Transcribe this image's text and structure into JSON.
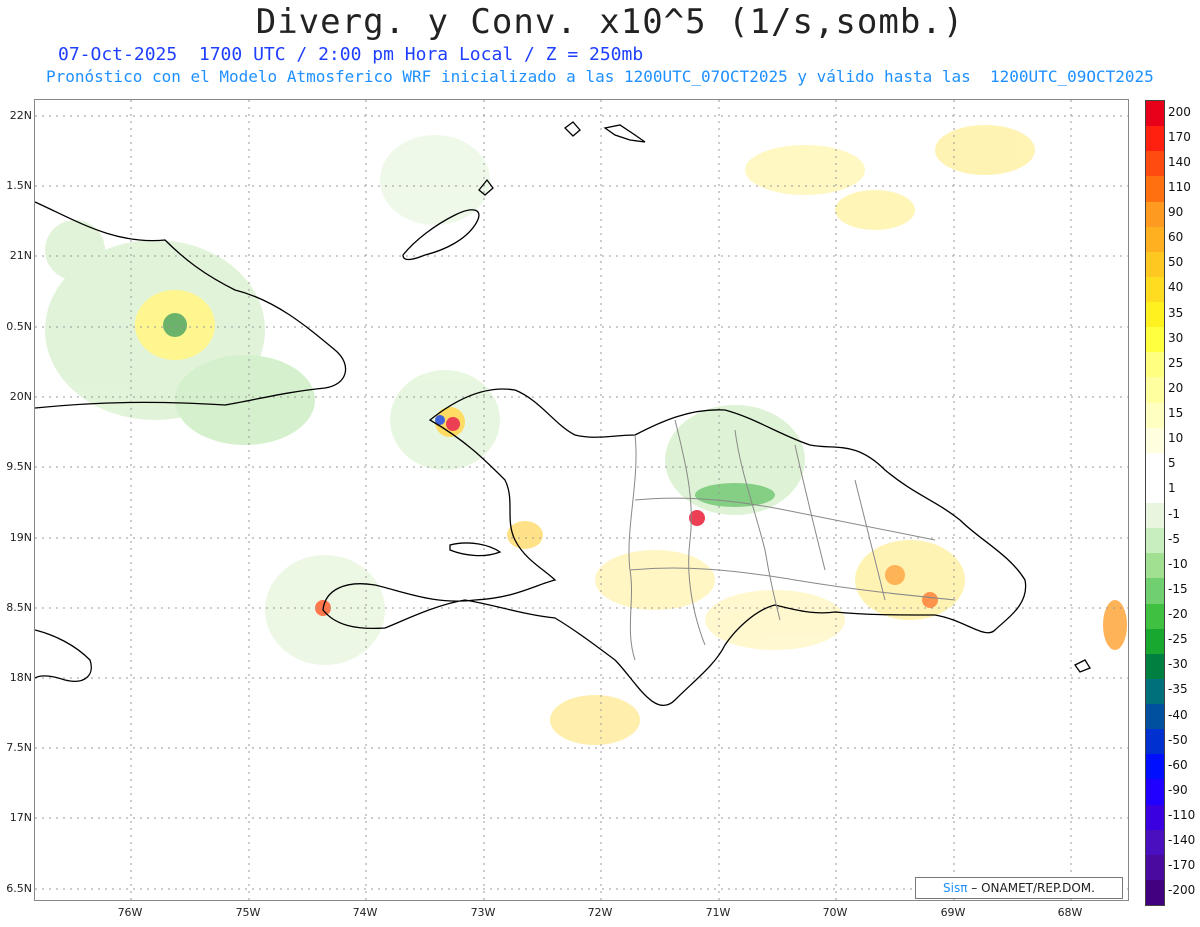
{
  "header": {
    "title": "Diverg. y Conv. x10^5 (1/s,somb.)",
    "line1": "07-Oct-2025  1700 UTC / 2:00 pm Hora Local / Z = 250mb",
    "line2": "Pronóstico con el Modelo Atmosferico WRF inicializado a las 1200UTC_07OCT2025 y válido hasta las  1200UTC_09OCT2025"
  },
  "map": {
    "lat_labels": [
      "22N",
      "1.5N",
      "21N",
      "0.5N",
      "20N",
      "9.5N",
      "19N",
      "8.5N",
      "18N",
      "7.5N",
      "17N",
      "6.5N"
    ],
    "lon_labels": [
      "76W",
      "75W",
      "74W",
      "73W",
      "72W",
      "71W",
      "70W",
      "69W",
      "68W"
    ],
    "credit_logo": "Sisπ",
    "credit_text": "– ONAMET/REP.DOM."
  },
  "colorbar": {
    "labels": [
      "200",
      "170",
      "140",
      "110",
      "90",
      "60",
      "50",
      "40",
      "35",
      "30",
      "25",
      "20",
      "15",
      "10",
      "5",
      "1",
      "-1",
      "-5",
      "-10",
      "-15",
      "-20",
      "-25",
      "-30",
      "-35",
      "-40",
      "-50",
      "-60",
      "-90",
      "-110",
      "-140",
      "-170",
      "-200"
    ],
    "colors": [
      "#e8001a",
      "#ff2010",
      "#ff4a10",
      "#ff7010",
      "#ff9a20",
      "#ffb020",
      "#ffc820",
      "#ffdc20",
      "#fff020",
      "#ffff40",
      "#ffff80",
      "#ffffa0",
      "#ffffc0",
      "#ffffe0",
      "#ffffff",
      "#ffffff",
      "#e8f6e0",
      "#c8eec0",
      "#a0e090",
      "#70d070",
      "#40c040",
      "#18a830",
      "#008040",
      "#00707a",
      "#0050a0",
      "#0030d0",
      "#0010ff",
      "#2000ff",
      "#3a00e0",
      "#4a10c0",
      "#4a0aa0",
      "#400080"
    ]
  }
}
